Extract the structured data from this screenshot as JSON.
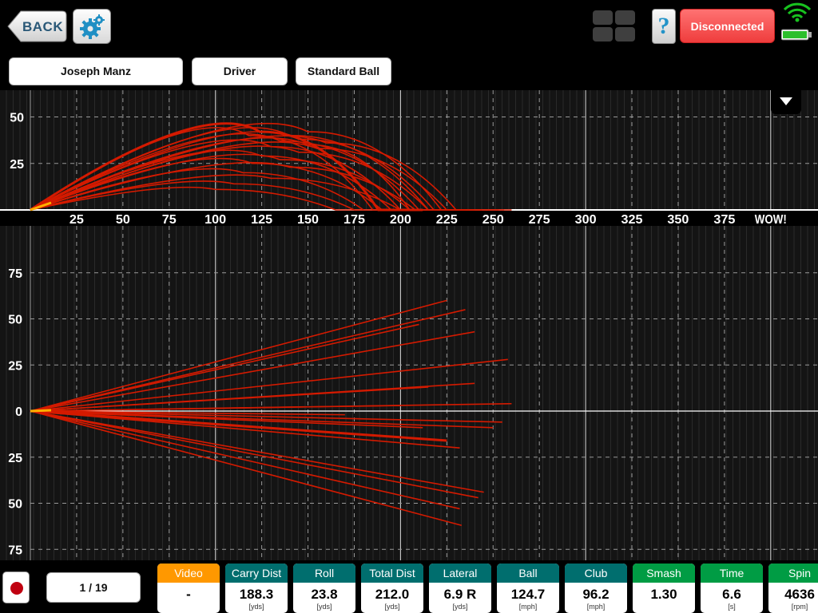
{
  "header": {
    "back_label": "BACK",
    "help_label": "?",
    "connection_status": "Disconnected",
    "player_name": "Joseph Manz",
    "club": "Driver",
    "ball_type": "Standard Ball"
  },
  "colors": {
    "teal": "#006e6e",
    "green": "#009c44",
    "orange": "#ff9800",
    "status_red": "#f04848",
    "trace_red": "#d41a00"
  },
  "chart_data": [
    {
      "type": "line",
      "title": "",
      "xlabel": "",
      "ylabel": "",
      "x_tick_labels": [
        "25",
        "50",
        "75",
        "100",
        "125",
        "150",
        "175",
        "200",
        "225",
        "250",
        "275",
        "300",
        "325",
        "350",
        "375",
        "WOW!"
      ],
      "y_tick_labels": [
        "50",
        "25"
      ],
      "xlim": [
        0,
        400
      ],
      "ylim": [
        -7,
        65
      ],
      "grid": true,
      "trajectories": [
        {
          "peak_x": 124,
          "apex": 42,
          "carry": 188,
          "roll": 24
        },
        {
          "peak_x": 118,
          "apex": 40,
          "carry": 185,
          "roll": 20
        },
        {
          "peak_x": 150,
          "apex": 42,
          "carry": 222,
          "roll": 34
        },
        {
          "peak_x": 140,
          "apex": 40,
          "carry": 215,
          "roll": 22
        },
        {
          "peak_x": 135,
          "apex": 37,
          "carry": 210,
          "roll": 20
        },
        {
          "peak_x": 150,
          "apex": 35,
          "carry": 205,
          "roll": 18
        },
        {
          "peak_x": 130,
          "apex": 34,
          "carry": 200,
          "roll": 20
        },
        {
          "peak_x": 145,
          "apex": 31,
          "carry": 215,
          "roll": 25
        },
        {
          "peak_x": 125,
          "apex": 29,
          "carry": 195,
          "roll": 18
        },
        {
          "peak_x": 135,
          "apex": 27,
          "carry": 205,
          "roll": 30
        },
        {
          "peak_x": 120,
          "apex": 25,
          "carry": 190,
          "roll": 22
        },
        {
          "peak_x": 140,
          "apex": 23,
          "carry": 208,
          "roll": 25
        },
        {
          "peak_x": 115,
          "apex": 20,
          "carry": 180,
          "roll": 15
        },
        {
          "peak_x": 130,
          "apex": 17,
          "carry": 200,
          "roll": 20
        },
        {
          "peak_x": 110,
          "apex": 14,
          "carry": 175,
          "roll": 18
        },
        {
          "peak_x": 100,
          "apex": 11,
          "carry": 165,
          "roll": 15
        },
        {
          "peak_x": 155,
          "apex": 33,
          "carry": 225,
          "roll": 28
        },
        {
          "peak_x": 145,
          "apex": 38,
          "carry": 218,
          "roll": 26
        },
        {
          "peak_x": 160,
          "apex": 36,
          "carry": 230,
          "roll": 30
        }
      ]
    },
    {
      "type": "line",
      "title": "",
      "xlabel": "",
      "ylabel": "",
      "y_tick_labels": [
        "75",
        "50",
        "25",
        "0",
        "25",
        "50",
        "75"
      ],
      "xlim": [
        0,
        400
      ],
      "ylim": [
        -82,
        100
      ],
      "grid": true,
      "dispersion": [
        {
          "x": 225,
          "y": 60
        },
        {
          "x": 235,
          "y": 55
        },
        {
          "x": 210,
          "y": 47
        },
        {
          "x": 240,
          "y": 43
        },
        {
          "x": 258,
          "y": 28
        },
        {
          "x": 240,
          "y": 15
        },
        {
          "x": 215,
          "y": 13
        },
        {
          "x": 260,
          "y": 4
        },
        {
          "x": 255,
          "y": -6
        },
        {
          "x": 250,
          "y": -9
        },
        {
          "x": 212,
          "y": -9
        },
        {
          "x": 225,
          "y": -16
        },
        {
          "x": 232,
          "y": -20
        },
        {
          "x": 245,
          "y": -44
        },
        {
          "x": 242,
          "y": -47
        },
        {
          "x": 232,
          "y": -53
        },
        {
          "x": 233,
          "y": -62
        },
        {
          "x": 170,
          "y": -2
        },
        {
          "x": 200,
          "y": 3
        }
      ]
    }
  ],
  "footer": {
    "shot_counter": "1 / 19",
    "metrics": [
      {
        "label": "Video",
        "value": "-",
        "unit": "",
        "color": "orange"
      },
      {
        "label": "Carry Dist",
        "value": "188.3",
        "unit": "[yds]",
        "color": "teal"
      },
      {
        "label": "Roll",
        "value": "23.8",
        "unit": "[yds]",
        "color": "teal"
      },
      {
        "label": "Total Dist",
        "value": "212.0",
        "unit": "[yds]",
        "color": "teal"
      },
      {
        "label": "Lateral",
        "value": "6.9 R",
        "unit": "[yds]",
        "color": "teal"
      },
      {
        "label": "Ball",
        "value": "124.7",
        "unit": "[mph]",
        "color": "teal"
      },
      {
        "label": "Club",
        "value": "96.2",
        "unit": "[mph]",
        "color": "teal"
      },
      {
        "label": "Smash",
        "value": "1.30",
        "unit": "",
        "color": "green"
      },
      {
        "label": "Time",
        "value": "6.6",
        "unit": "[s]",
        "color": "green"
      },
      {
        "label": "Spin",
        "value": "4636",
        "unit": "[rpm]",
        "color": "green"
      }
    ]
  }
}
